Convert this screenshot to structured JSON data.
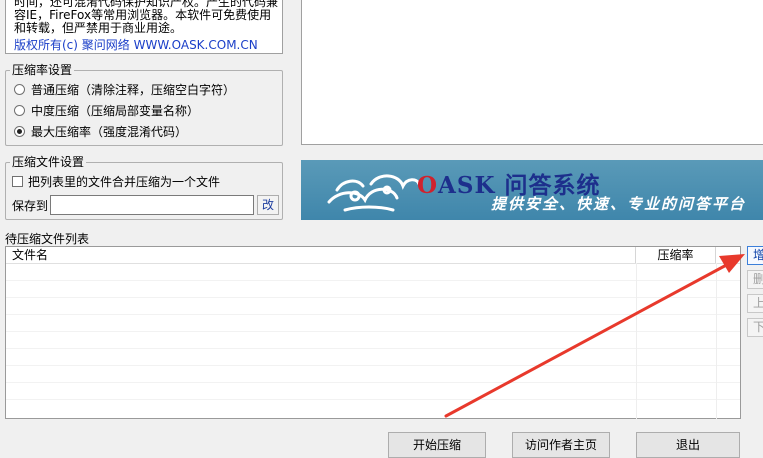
{
  "about": {
    "line1": "时间，还可混淆代码保护知识产权。产生的代码兼",
    "line2": "容IE，FireFox等常用浏览器。本软件可免费使用",
    "line3": "和转载，但严禁用于商业用途。",
    "copyright": "版权所有(c) 聚问网络 WWW.OASK.COM.CN"
  },
  "compress_rate": {
    "title": "压缩率设置",
    "options": [
      {
        "label": "普通压缩（清除注释，压缩空白字符）",
        "checked": false
      },
      {
        "label": "中度压缩（压缩局部变量名称）",
        "checked": false
      },
      {
        "label": "最大压缩率（强度混淆代码）",
        "checked": true
      }
    ]
  },
  "compress_file": {
    "title": "压缩文件设置",
    "merge_label": "把列表里的文件合并压缩为一个文件",
    "merge_checked": false,
    "save_label": "保存到",
    "save_value": "",
    "change_label": "改"
  },
  "banner": {
    "title_o": "O",
    "title_rest": "ASK 问答系统",
    "subtitle": "提供安全、快速、专业的问答平台"
  },
  "file_list": {
    "title": "待压缩文件列表",
    "columns": [
      "文件名",
      "压缩率"
    ],
    "rows": []
  },
  "side_buttons": {
    "add": "增",
    "delete": "删",
    "up": "上",
    "down": "下"
  },
  "bottom_buttons": {
    "start": "开始压缩",
    "visit": "访问作者主页",
    "exit": "退出"
  },
  "colors": {
    "arrow": "#e8392c",
    "banner": "#4a8fb3"
  }
}
